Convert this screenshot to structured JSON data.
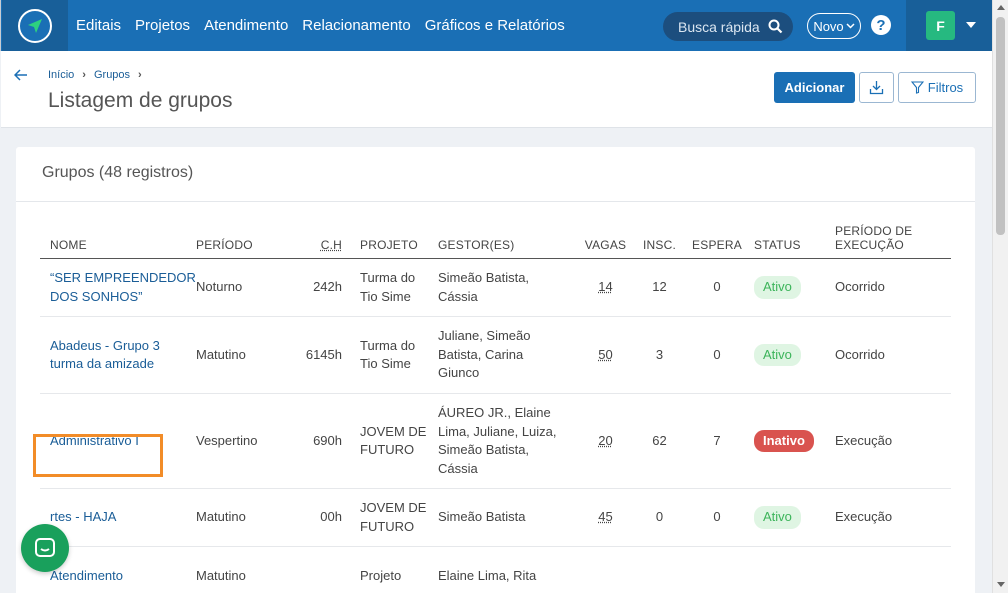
{
  "nav": {
    "items": [
      "Editais",
      "Projetos",
      "Atendimento",
      "Relacionamento",
      "Gráficos e Relatórios"
    ],
    "search_placeholder": "Busca rápida",
    "novo_label": "Novo",
    "help_label": "?",
    "user_initial": "F"
  },
  "header": {
    "breadcrumb": [
      "Início",
      "Grupos"
    ],
    "title": "Listagem de grupos",
    "add_label": "Adicionar",
    "filter_label": "Filtros"
  },
  "card": {
    "title": "Grupos (48 registros)"
  },
  "table": {
    "columns": {
      "nome": "NOME",
      "periodo": "PERÍODO",
      "ch": "C.H",
      "projeto": "PROJETO",
      "gestor": "GESTOR(ES)",
      "vagas": "VAGAS",
      "insc": "INSC.",
      "espera": "ESPERA",
      "status": "STATUS",
      "exec_line1": "PERÍODO DE",
      "exec_line2": "EXECUÇÃO"
    },
    "rows": [
      {
        "nome": [
          "“SER EMPREENDEDOR",
          "DOS SONHOS”"
        ],
        "periodo": "Noturno",
        "ch": "242h",
        "projeto": [
          "Turma do",
          "Tio Sime"
        ],
        "gestor": [
          "Simeão Batista,",
          "Cássia"
        ],
        "vagas": "14",
        "insc": "12",
        "espera": "0",
        "status": "Ativo",
        "exec": "Ocorrido"
      },
      {
        "nome": [
          "Abadeus - Grupo 3",
          "turma da amizade"
        ],
        "periodo": "Matutino",
        "ch": "6145h",
        "projeto": [
          "Turma do",
          "Tio Sime"
        ],
        "gestor": [
          "Juliane, Simeão",
          "Batista, Carina",
          "Giunco"
        ],
        "vagas": "50",
        "insc": "3",
        "espera": "0",
        "status": "Ativo",
        "exec": "Ocorrido"
      },
      {
        "nome": [
          "Administrativo I"
        ],
        "periodo": "Vespertino",
        "ch": "690h",
        "projeto": [
          "JOVEM DE",
          "FUTURO"
        ],
        "gestor": [
          "ÁUREO JR., Elaine",
          "Lima, Juliane, Luiza,",
          "Simeão Batista,",
          "Cássia"
        ],
        "vagas": "20",
        "insc": "62",
        "espera": "7",
        "status": "Inativo",
        "exec": "Execução"
      },
      {
        "nome": [
          "rtes - HAJA"
        ],
        "periodo": "Matutino",
        "ch": "00h",
        "projeto": [
          "JOVEM DE",
          "FUTURO"
        ],
        "gestor": [
          "Simeão Batista"
        ],
        "vagas": "45",
        "insc": "0",
        "espera": "0",
        "status": "Ativo",
        "exec": "Execução"
      },
      {
        "nome": [
          "Atendimento"
        ],
        "periodo": "Matutino",
        "ch": "",
        "projeto": [
          "Projeto"
        ],
        "gestor": [
          "Elaine Lima, Rita"
        ],
        "vagas": "",
        "insc": "",
        "espera": "",
        "status": "",
        "exec": ""
      }
    ]
  },
  "colors": {
    "primary": "#1a6fb5",
    "active_badge_bg": "#dff5e3",
    "active_badge_text": "#3cb45a",
    "inactive_badge": "#d9534f",
    "highlight": "#f28c28",
    "chat": "#19a05c"
  }
}
